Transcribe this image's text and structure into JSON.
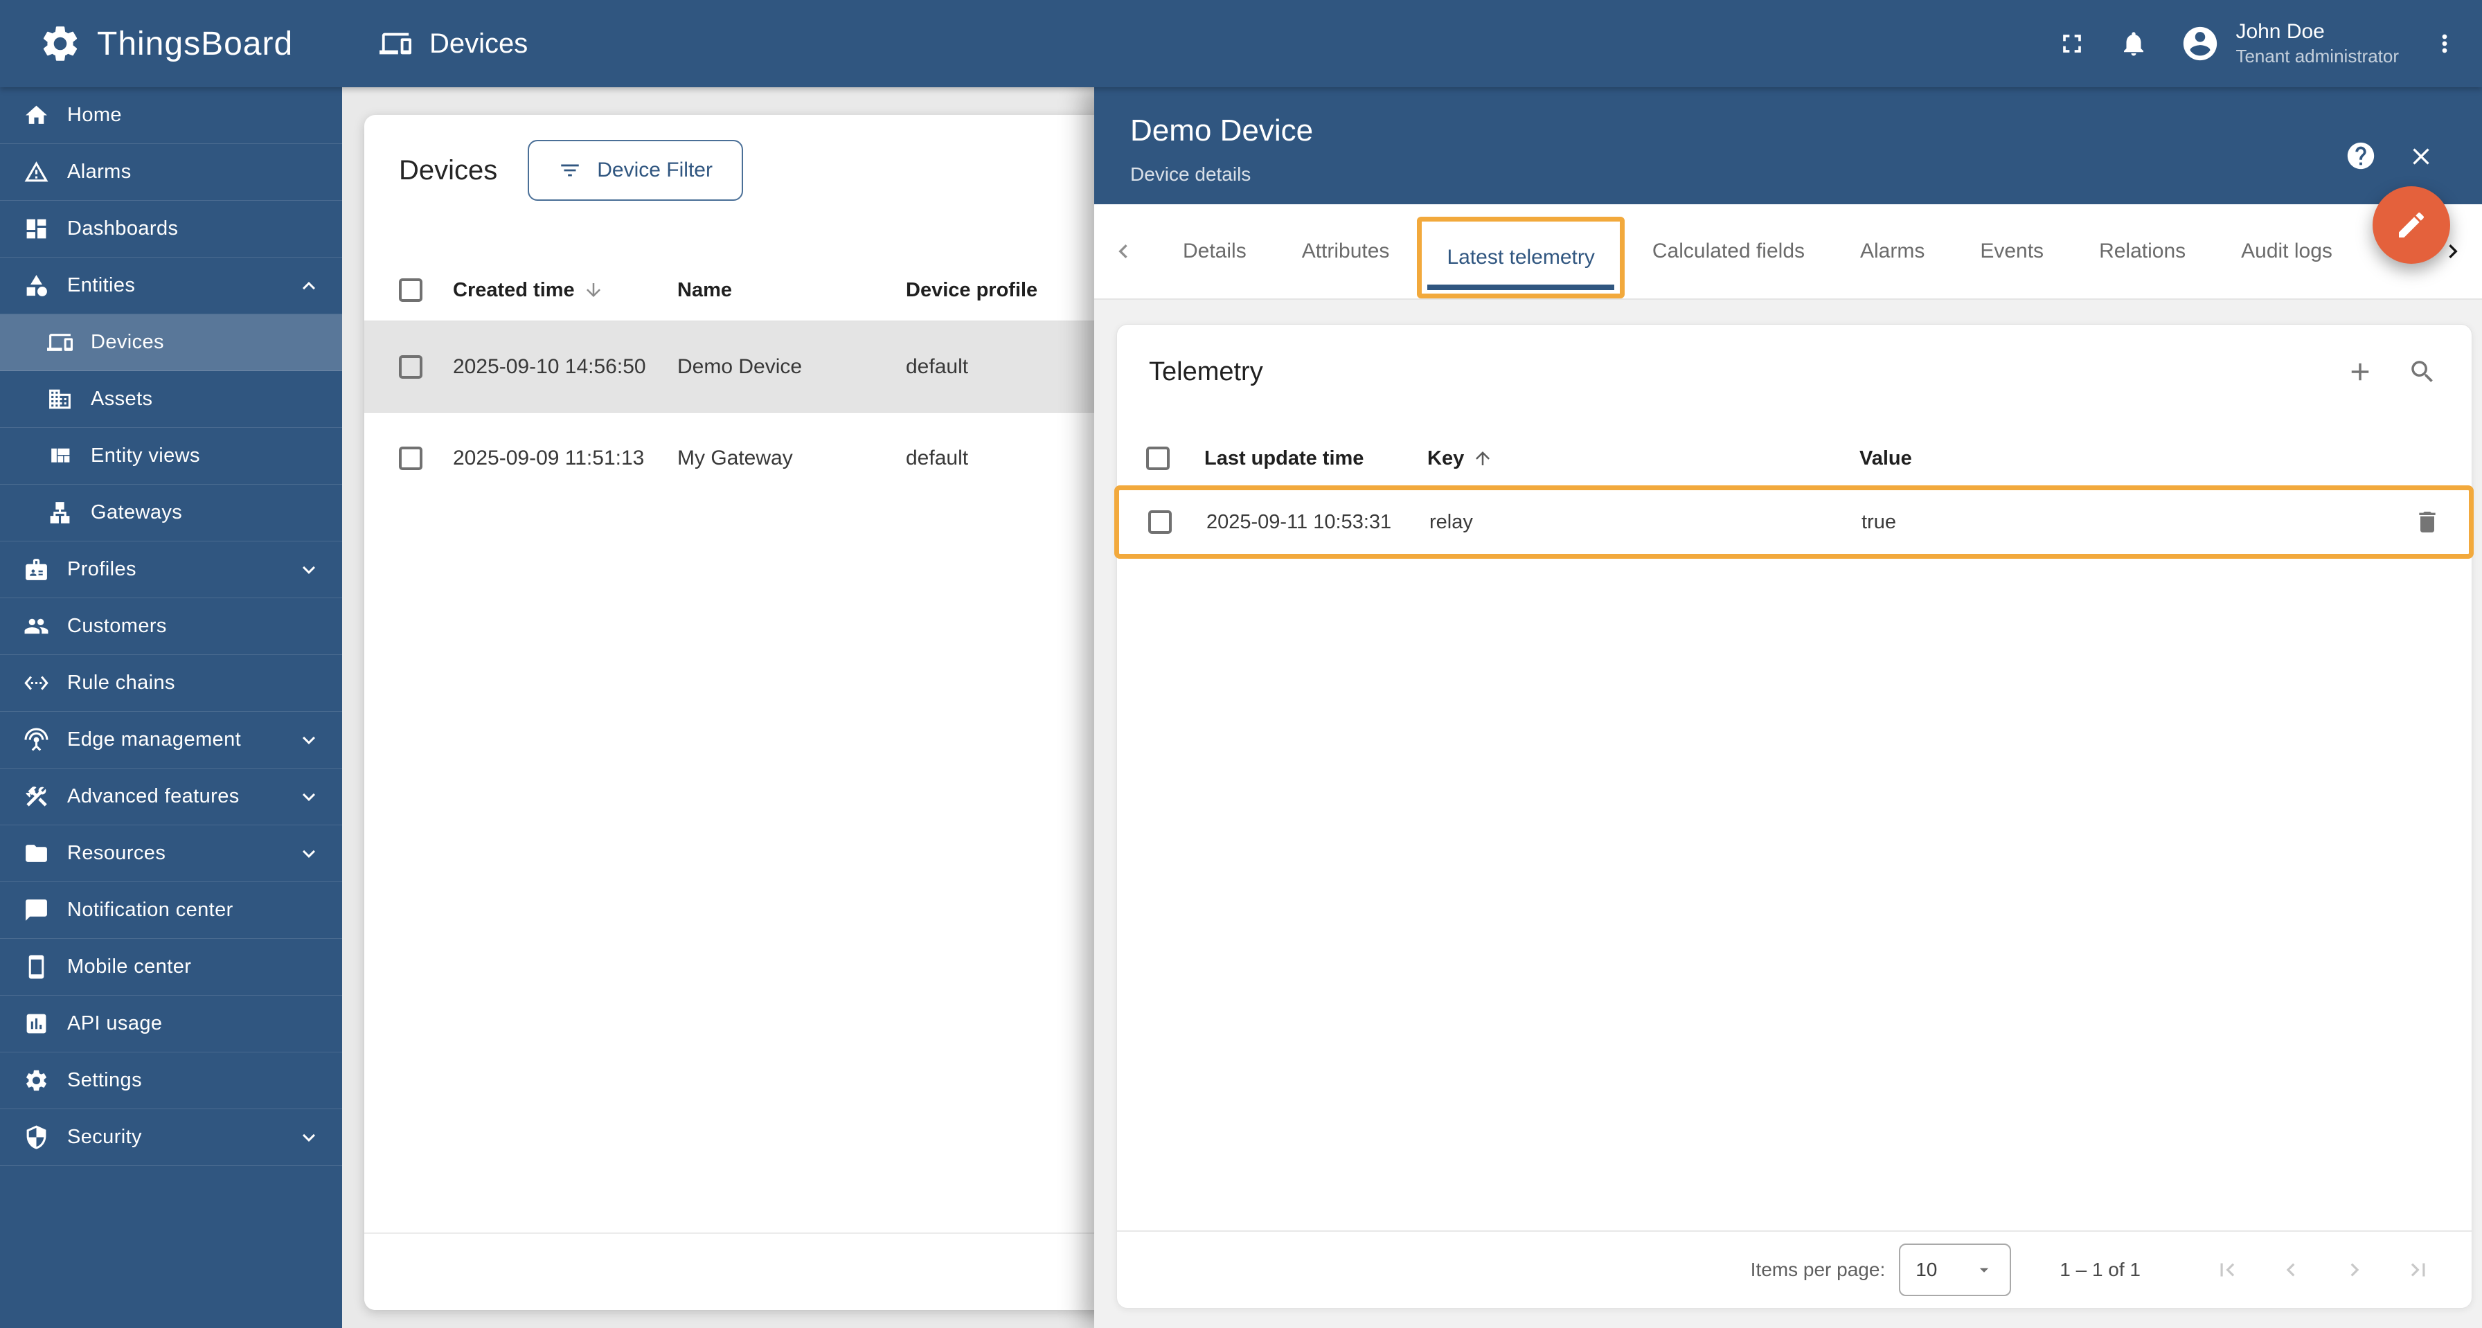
{
  "colors": {
    "primary": "#305680",
    "fab_orange": "#e4613c",
    "tutorial_highlight": "#f2a93c",
    "selected_row": "#e4e4e4"
  },
  "topbar": {
    "logo_text": "ThingsBoard",
    "page_title": "Devices",
    "icons": [
      "fullscreen-icon",
      "notifications-bell-icon",
      "account-circle-icon",
      "more-vert-icon"
    ],
    "user_name": "John Doe",
    "user_role": "Tenant administrator"
  },
  "sidebar": {
    "items": [
      {
        "label": "Home",
        "icon": "home"
      },
      {
        "label": "Alarms",
        "icon": "warning-triangle"
      },
      {
        "label": "Dashboards",
        "icon": "dashboard"
      },
      {
        "label": "Entities",
        "icon": "category-shapes",
        "expanded": true
      },
      {
        "label": "Devices",
        "icon": "devices",
        "child": true,
        "active": true
      },
      {
        "label": "Assets",
        "icon": "building",
        "child": true
      },
      {
        "label": "Entity views",
        "icon": "view-quilt",
        "child": true
      },
      {
        "label": "Gateways",
        "icon": "lan-tree",
        "child": true
      },
      {
        "label": "Profiles",
        "icon": "badge",
        "collapsible": true
      },
      {
        "label": "Customers",
        "icon": "people"
      },
      {
        "label": "Rule chains",
        "icon": "settings-ethernet"
      },
      {
        "label": "Edge management",
        "icon": "antenna",
        "collapsible": true
      },
      {
        "label": "Advanced features",
        "icon": "tools",
        "collapsible": true
      },
      {
        "label": "Resources",
        "icon": "folder",
        "collapsible": true
      },
      {
        "label": "Notification center",
        "icon": "message-bubble"
      },
      {
        "label": "Mobile center",
        "icon": "smartphone"
      },
      {
        "label": "API usage",
        "icon": "bar-chart-box"
      },
      {
        "label": "Settings",
        "icon": "gear"
      },
      {
        "label": "Security",
        "icon": "shield",
        "collapsible": true
      }
    ]
  },
  "devices_panel": {
    "title": "Devices",
    "filter_button_label": "Device Filter",
    "columns": {
      "created": "Created time",
      "name": "Name",
      "profile": "Device profile"
    },
    "sort_column": "Created time",
    "sort_direction": "desc",
    "rows": [
      {
        "created": "2025-09-10 14:56:50",
        "name": "Demo Device",
        "profile": "default",
        "selected": true
      },
      {
        "created": "2025-09-09 11:51:13",
        "name": "My Gateway",
        "profile": "default",
        "selected": false
      }
    ]
  },
  "drawer": {
    "title": "Demo Device",
    "subtitle": "Device details",
    "tabs": [
      "Details",
      "Attributes",
      "Latest telemetry",
      "Calculated fields",
      "Alarms",
      "Events",
      "Relations",
      "Audit logs"
    ],
    "active_tab": "Latest telemetry",
    "telemetry": {
      "title": "Telemetry",
      "columns": {
        "time": "Last update time",
        "key": "Key",
        "value": "Value"
      },
      "sort_column": "Key",
      "sort_direction": "asc",
      "rows": [
        {
          "time": "2025-09-11 10:53:31",
          "key": "relay",
          "value": "true"
        }
      ]
    },
    "pagination": {
      "items_per_page_label": "Items per page:",
      "page_size": "10",
      "range_label": "1 – 1 of 1"
    }
  }
}
